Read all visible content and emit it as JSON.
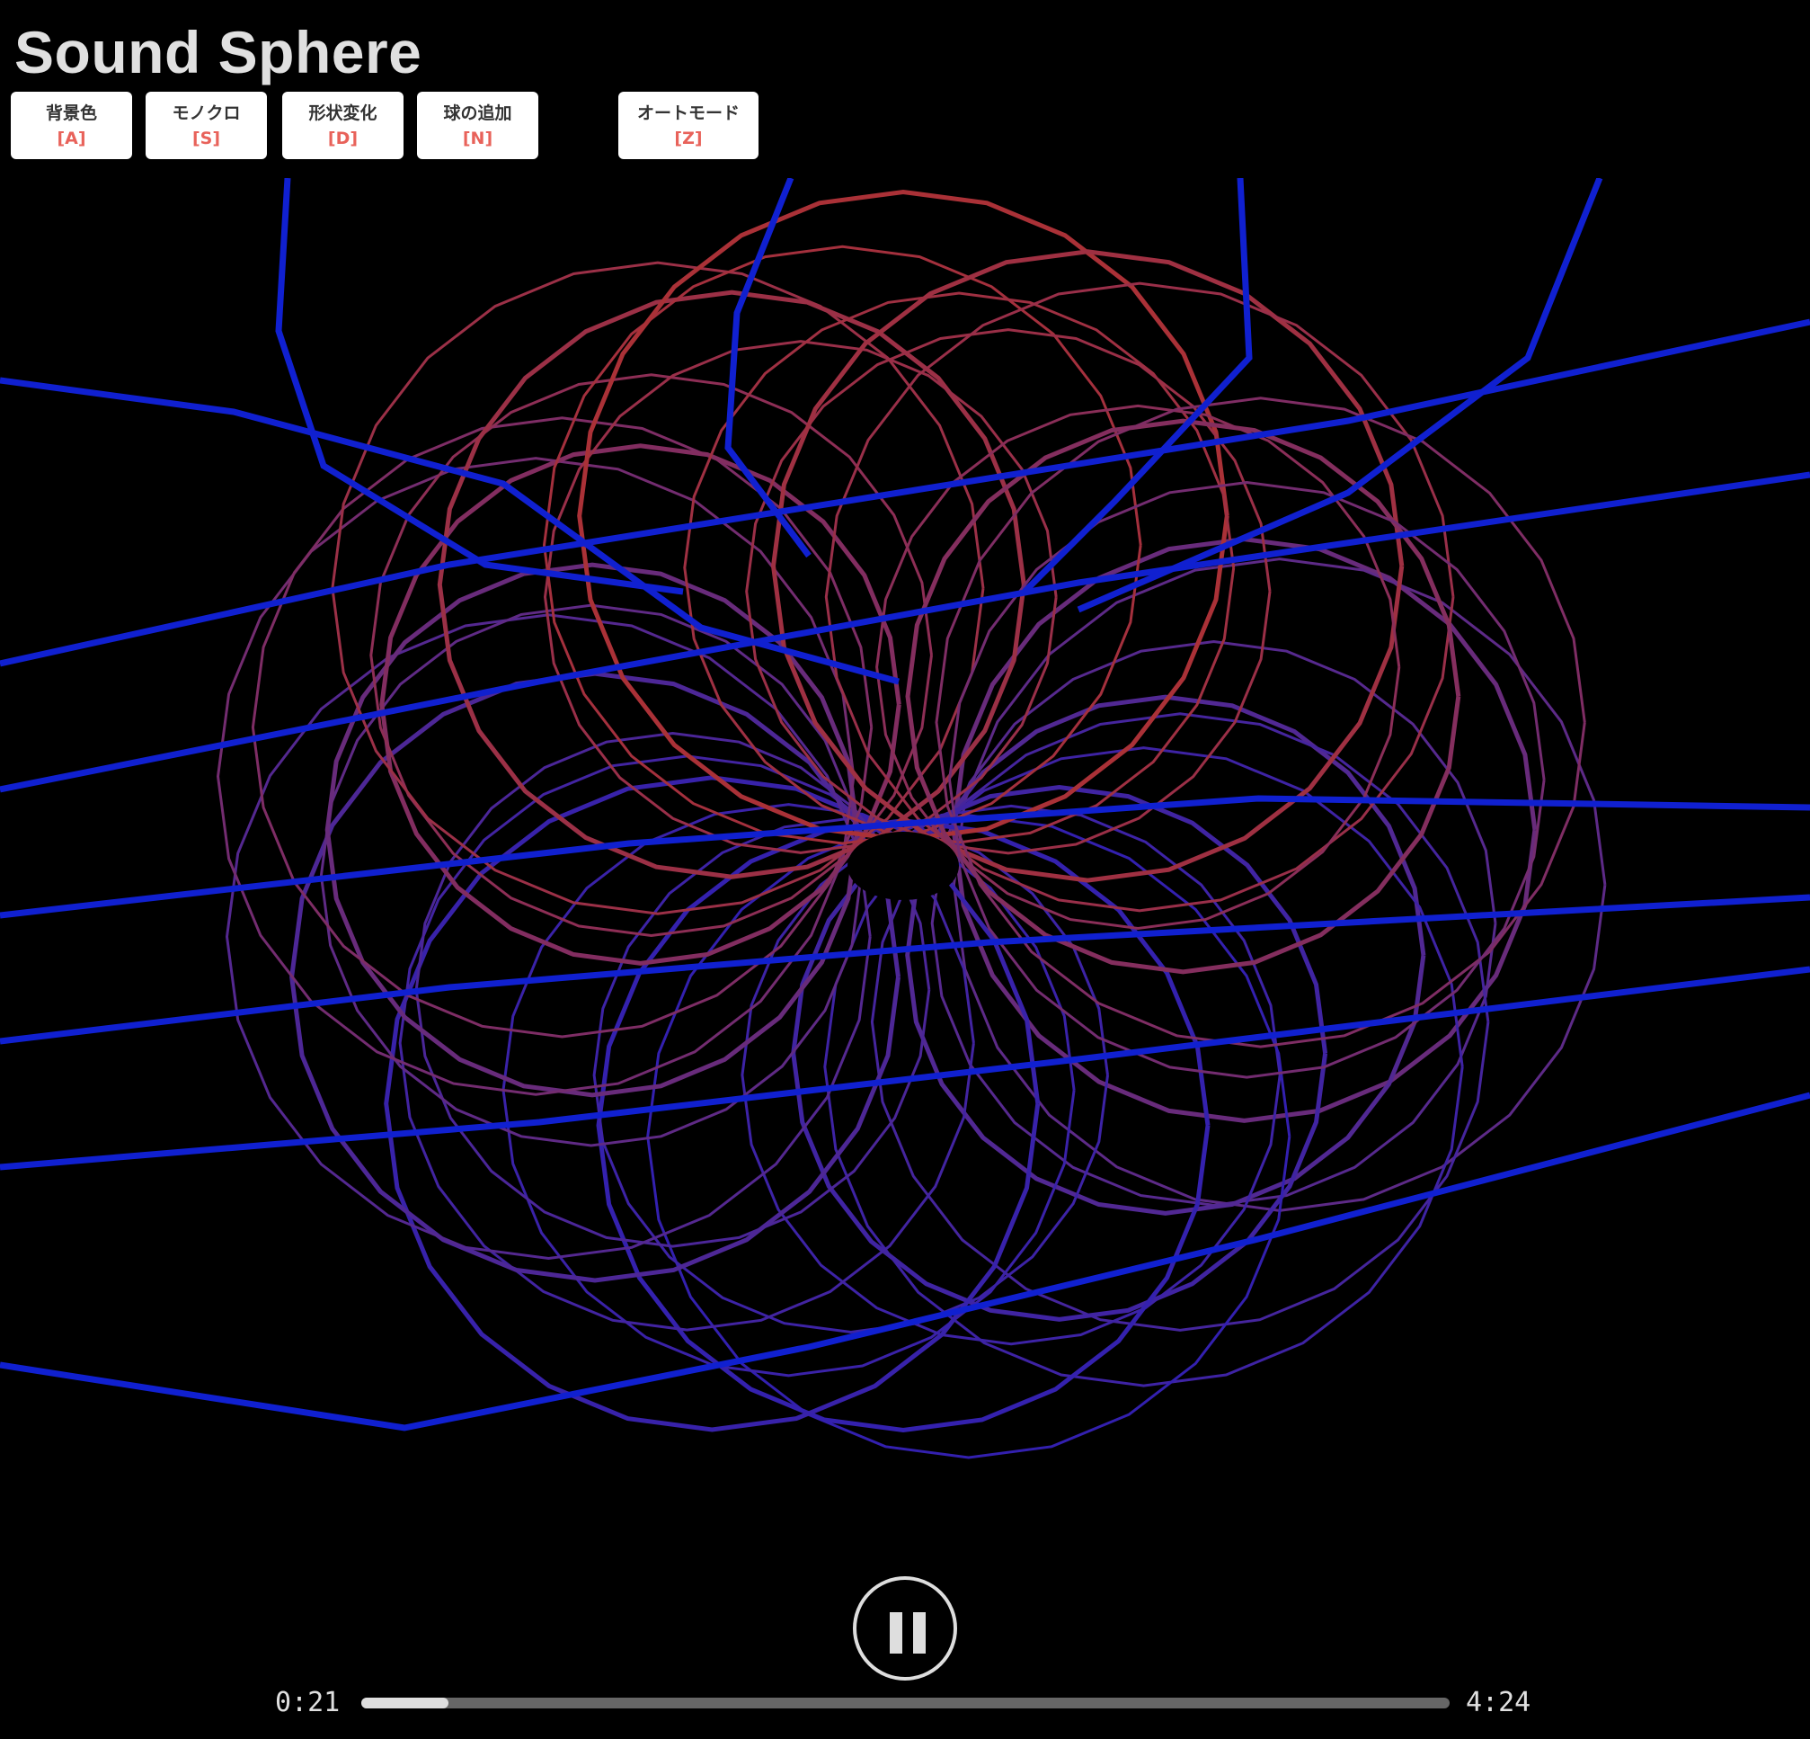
{
  "app": {
    "title": "Sound Sphere"
  },
  "controls": [
    {
      "label": "背景色",
      "key": "[A]"
    },
    {
      "label": "モノクロ",
      "key": "[S]"
    },
    {
      "label": "形状変化",
      "key": "[D]"
    },
    {
      "label": "球の追加",
      "key": "[N]"
    },
    {
      "label": "オートモード",
      "key": "[Z]"
    }
  ],
  "visualization": {
    "description": "wireframe sound sphere visualization",
    "colors": {
      "outer": "#b83228",
      "mid": "#5a2a8a",
      "inner": "#1018d0",
      "background": "#000000"
    }
  },
  "player": {
    "state": "playing",
    "icon": "pause-icon",
    "current_time": "0:21",
    "total_time": "4:24",
    "progress": 0.08
  },
  "theme": {
    "key_color": "#e8625a",
    "text_color": "#e0e0e0"
  }
}
